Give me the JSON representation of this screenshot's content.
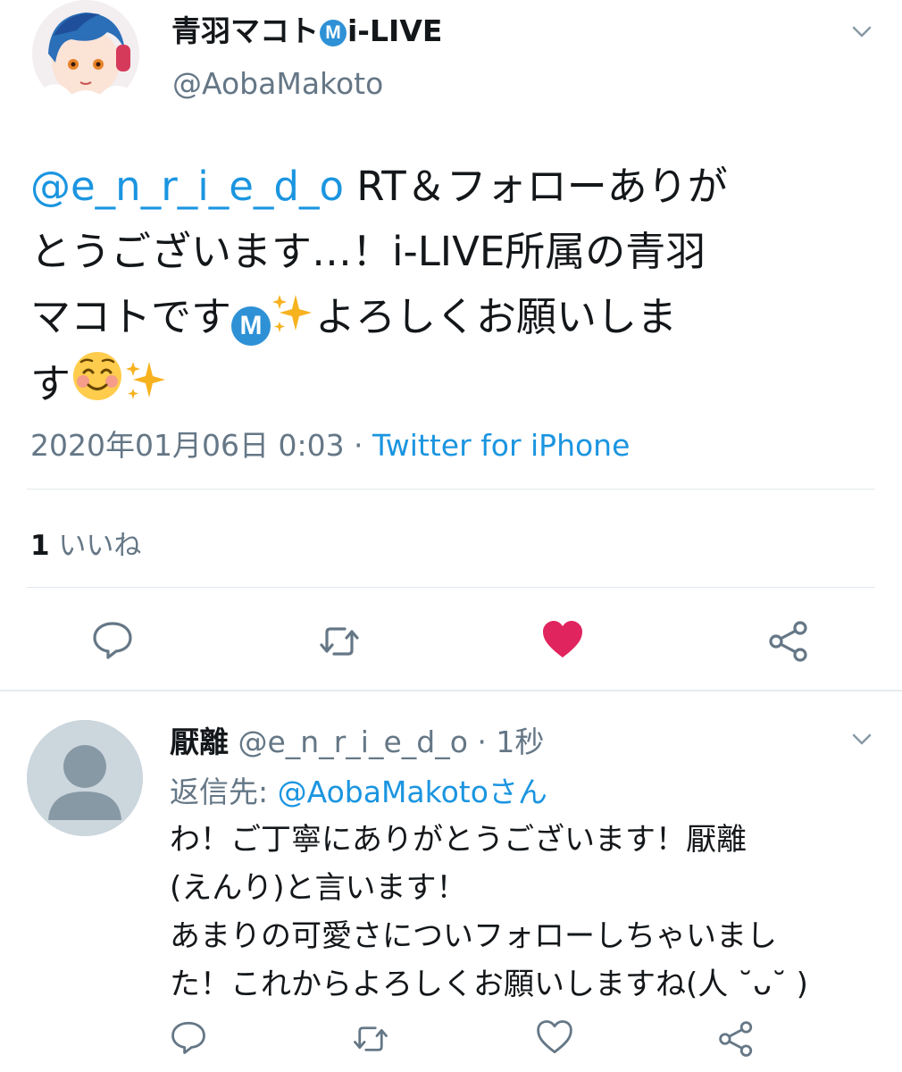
{
  "tweet": {
    "author": {
      "name": "青羽マコト",
      "badge": "M",
      "name_suffix": "i-LIVE",
      "handle": "@AobaMakoto"
    },
    "text": {
      "mention": "@e_n_r_i_e_d_o",
      "line1_rest": " RT＆フォローありが",
      "line2": "とうございます…！i-LIVE所属の青羽",
      "line3_start": "マコトです",
      "inline_badge": "M",
      "line3_end": "よろしくお願いしま",
      "line4_start": "す"
    },
    "timestamp": "2020年01月06日 0:03",
    "meta_separator": " · ",
    "source": "Twitter for iPhone",
    "likes_count": "1",
    "likes_label": " いいね",
    "liked": true
  },
  "reply": {
    "author": {
      "name": "厭離",
      "handle": "@e_n_r_i_e_d_o",
      "time_separator": " · ",
      "time": "1秒"
    },
    "reply_to_label": "返信先: ",
    "reply_to_handle": "@AobaMakotoさん",
    "text_lines": [
      "わ！ご丁寧にありがとうございます！厭離",
      "(えんり)と言います！",
      "あまりの可愛さについフォローしちゃいまし",
      "た！これからよろしくお願いしますね(人 ˘ᴗ˘ )"
    ]
  },
  "icons": {
    "reply": "comment-bubble-icon",
    "retweet": "retweet-icon",
    "like": "heart-icon",
    "share": "share-icon",
    "more": "chevron-down-icon"
  },
  "colors": {
    "link": "#1b95e0",
    "muted": "#657786",
    "like_active": "#e0245e",
    "badge": "#2e91d6"
  }
}
